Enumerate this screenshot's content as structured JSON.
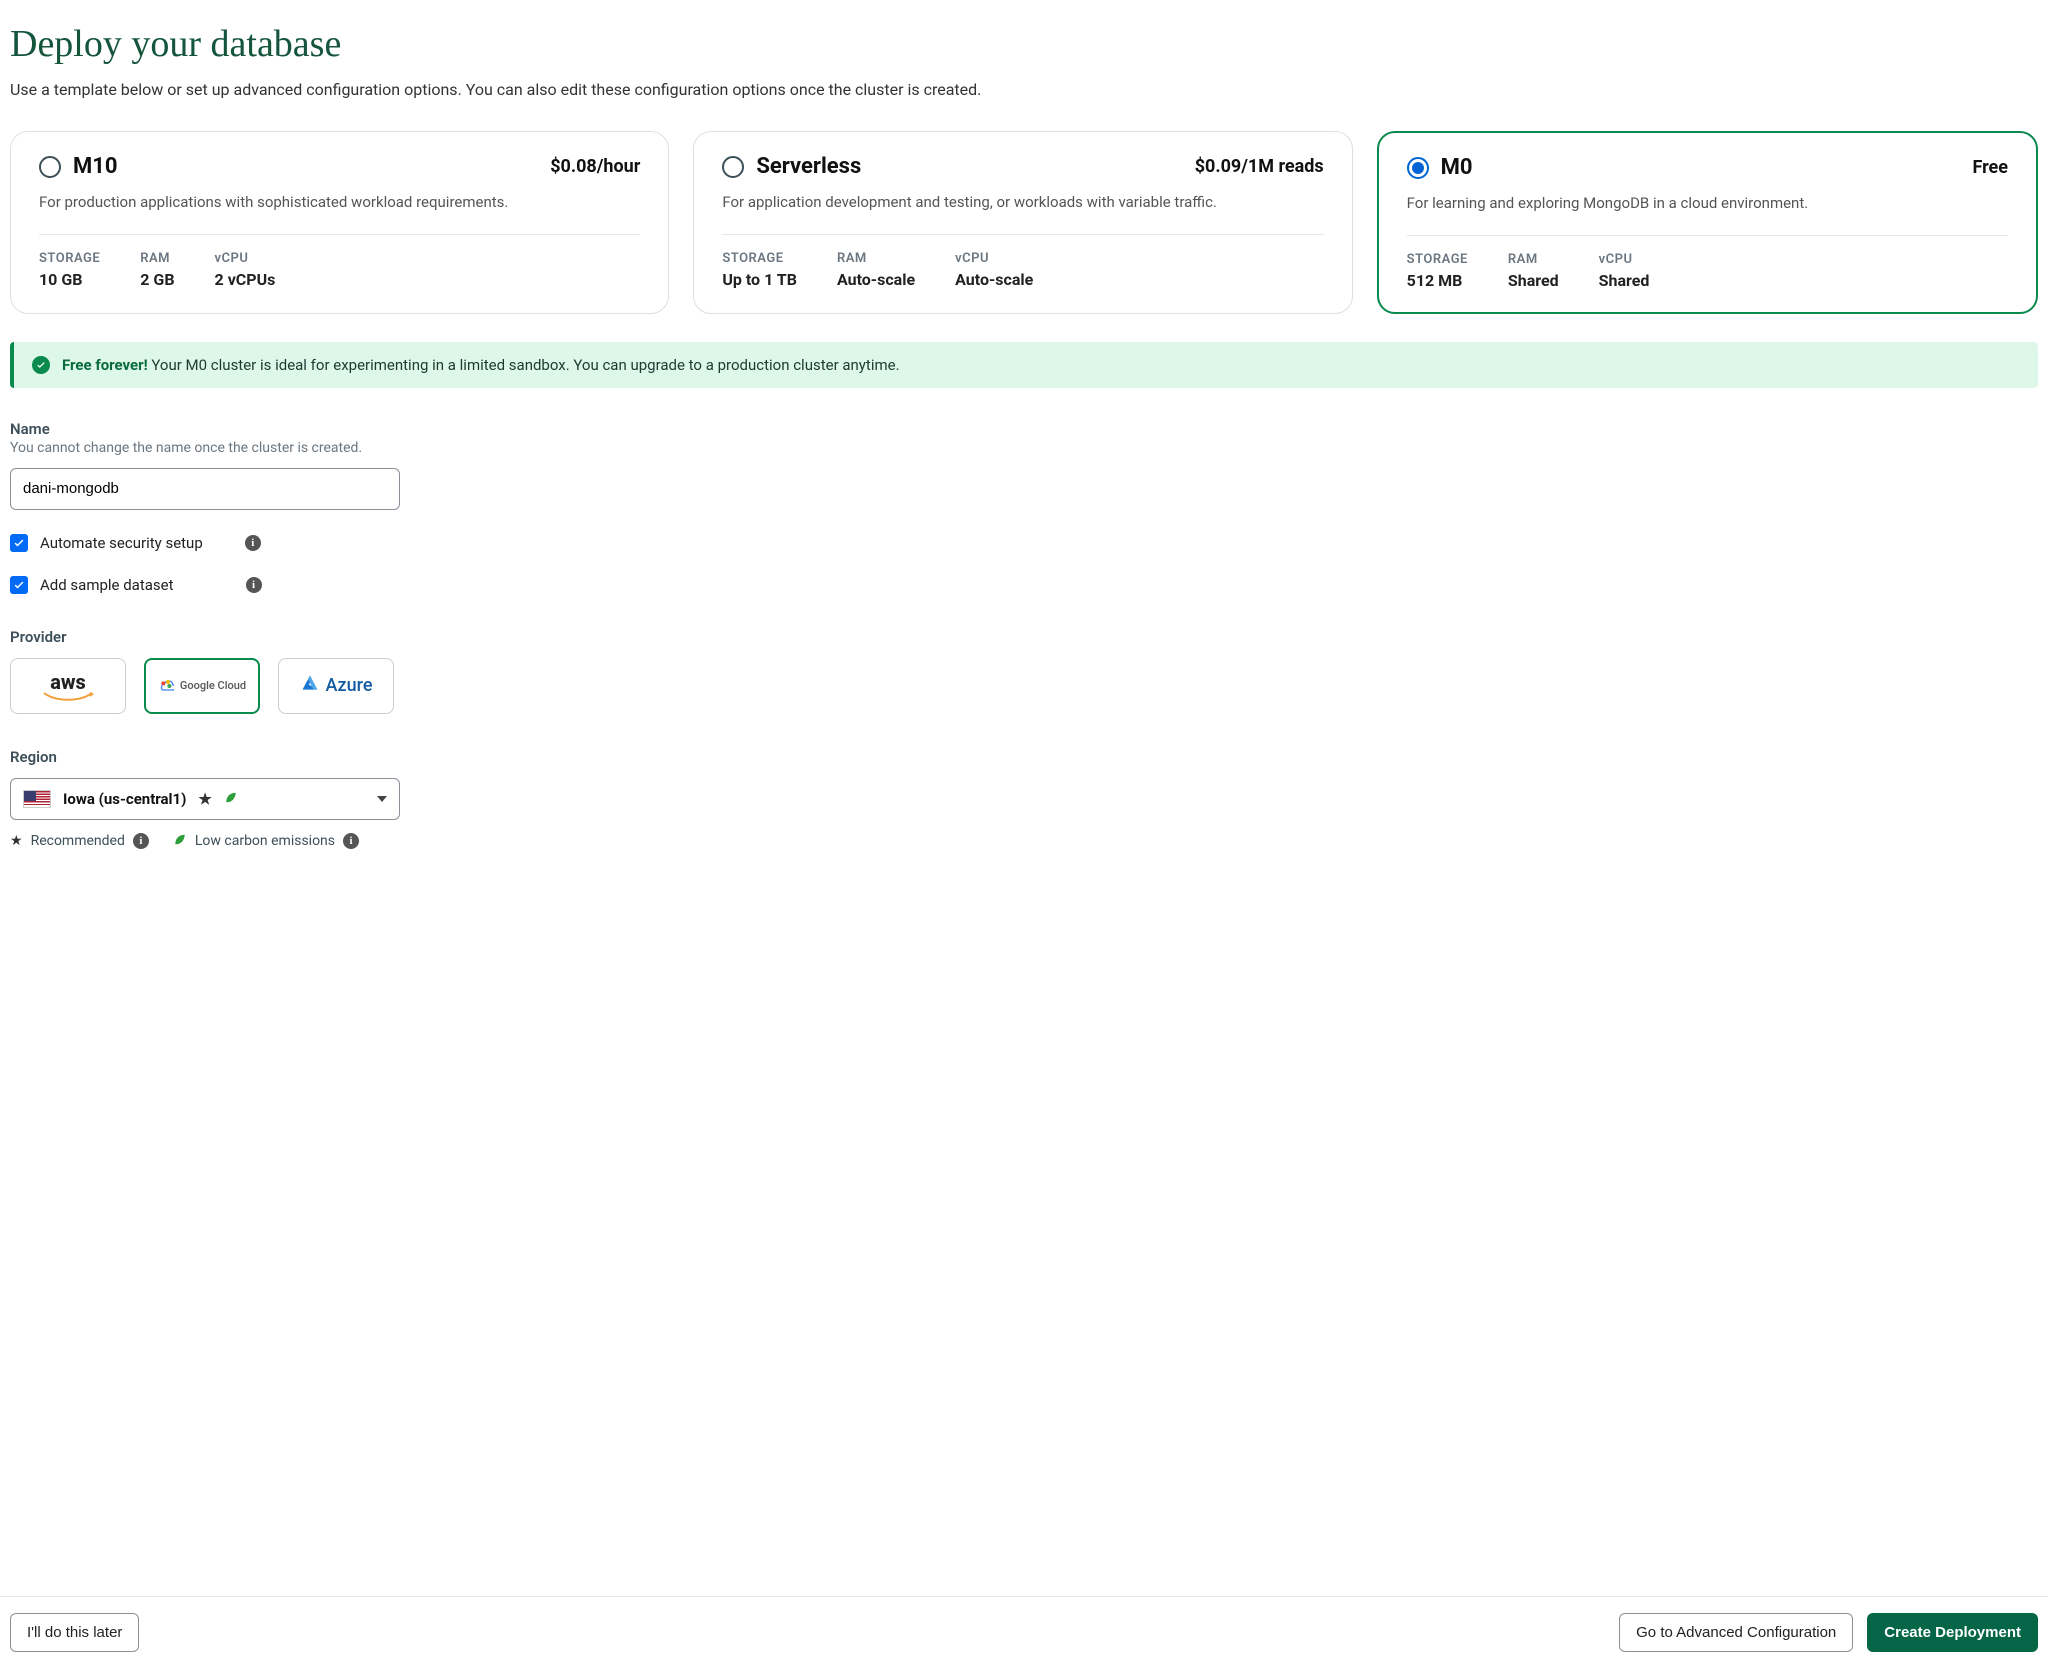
{
  "header": {
    "page_title": "Deploy your database",
    "subtitle": "Use a template below or set up advanced configuration options. You can also edit these configuration options once the cluster is created."
  },
  "plans": [
    {
      "id": "m10",
      "name": "M10",
      "price": "$0.08/hour",
      "desc": "For production applications with sophisticated workload requirements.",
      "storage_label": "STORAGE",
      "storage_value": "10 GB",
      "ram_label": "RAM",
      "ram_value": "2 GB",
      "vcpu_label": "vCPU",
      "vcpu_value": "2 vCPUs",
      "selected": false
    },
    {
      "id": "serverless",
      "name": "Serverless",
      "price": "$0.09/1M reads",
      "desc": "For application development and testing, or workloads with variable traffic.",
      "storage_label": "STORAGE",
      "storage_value": "Up to 1 TB",
      "ram_label": "RAM",
      "ram_value": "Auto-scale",
      "vcpu_label": "vCPU",
      "vcpu_value": "Auto-scale",
      "selected": false
    },
    {
      "id": "m0",
      "name": "M0",
      "price": "Free",
      "desc": "For learning and exploring MongoDB in a cloud environment.",
      "storage_label": "STORAGE",
      "storage_value": "512 MB",
      "ram_label": "RAM",
      "ram_value": "Shared",
      "vcpu_label": "vCPU",
      "vcpu_value": "Shared",
      "selected": true
    }
  ],
  "banner": {
    "strong": "Free forever!",
    "text": " Your M0 cluster is ideal for experimenting in a limited sandbox. You can upgrade to a production cluster anytime."
  },
  "name_field": {
    "label": "Name",
    "help": "You cannot change the name once the cluster is created.",
    "value": "dani-mongodb"
  },
  "checkboxes": {
    "security": {
      "label": "Automate security setup",
      "checked": true
    },
    "sample": {
      "label": "Add sample dataset",
      "checked": true
    }
  },
  "provider": {
    "label": "Provider",
    "options": [
      {
        "id": "aws",
        "label": "aws",
        "selected": false
      },
      {
        "id": "gcloud",
        "label": "Google Cloud",
        "selected": true
      },
      {
        "id": "azure",
        "label": "Azure",
        "selected": false
      }
    ]
  },
  "region": {
    "label": "Region",
    "selected_text": "Iowa (us-central1)",
    "legend_recommended": "Recommended",
    "legend_lowcarbon": "Low carbon emissions"
  },
  "footer": {
    "later_btn": "I'll do this later",
    "advanced_btn": "Go to Advanced Configuration",
    "create_btn": "Create Deployment"
  }
}
